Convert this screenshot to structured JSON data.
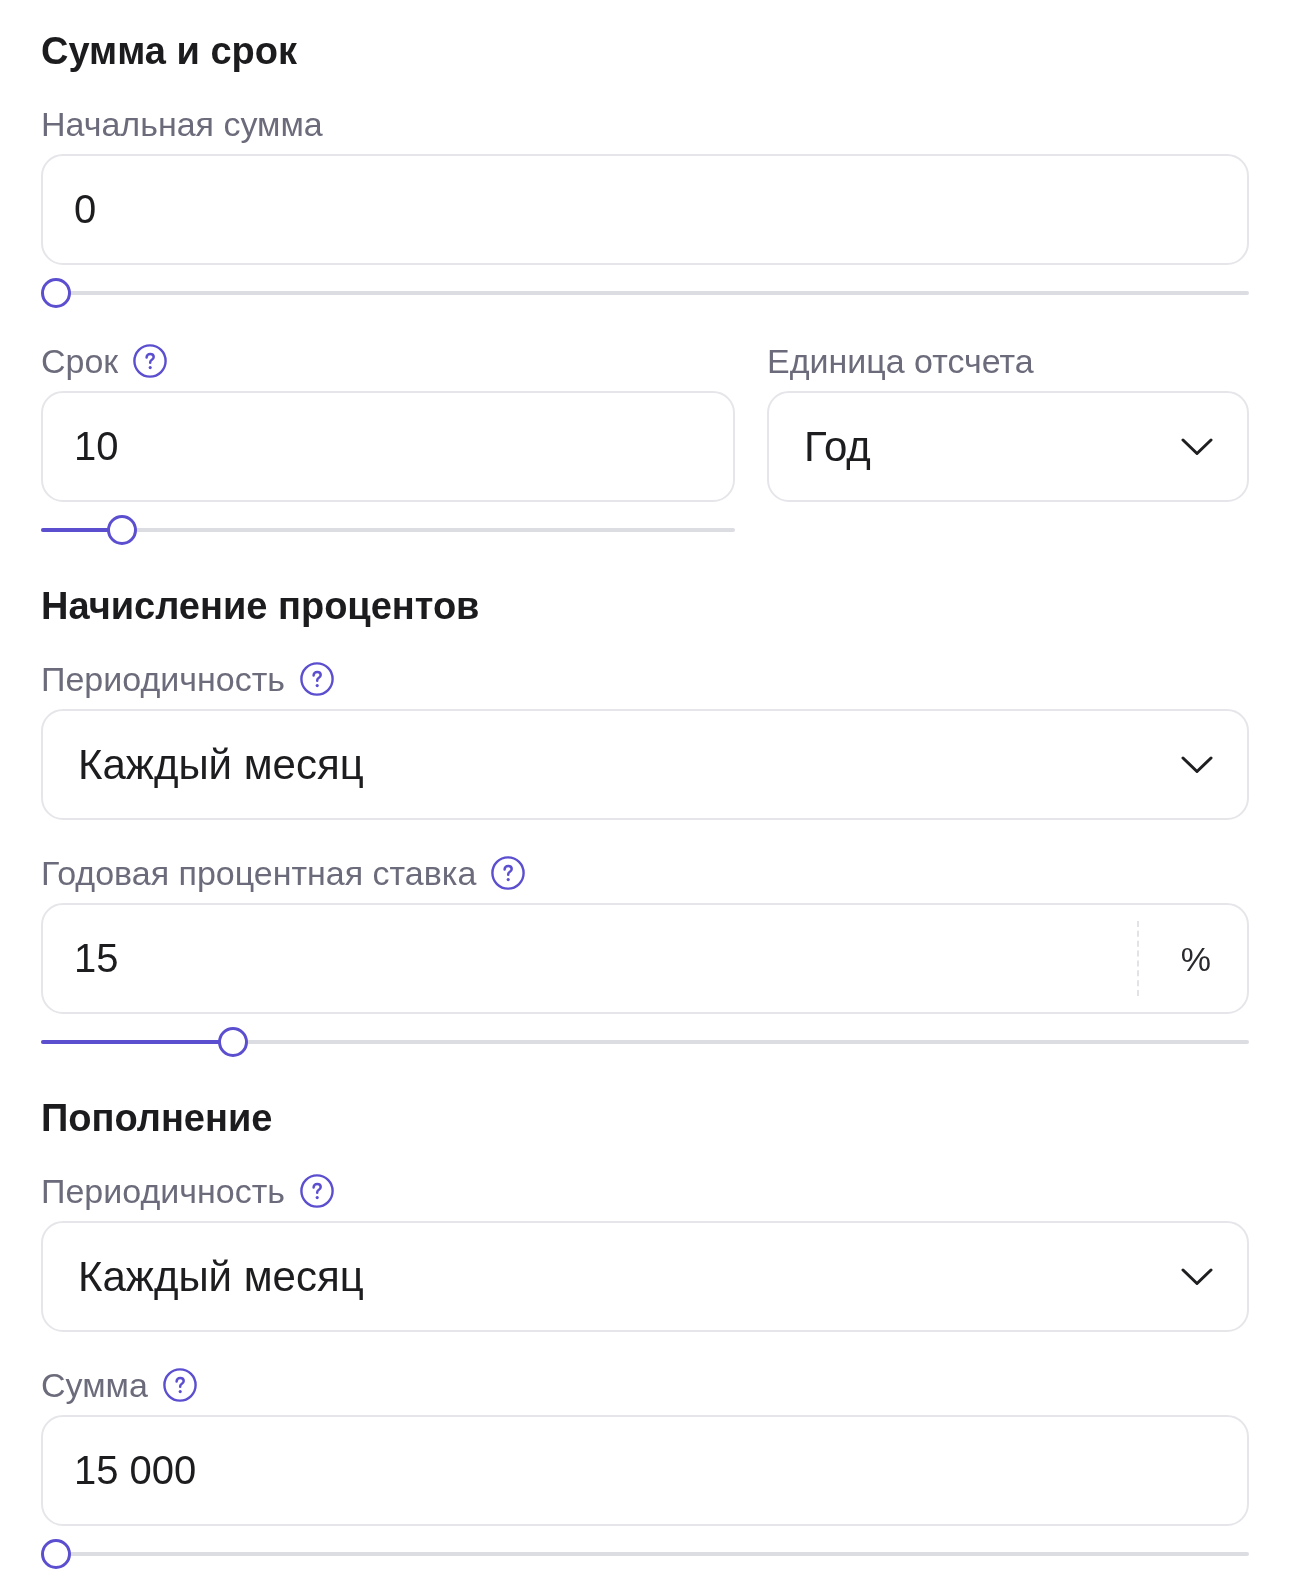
{
  "sections": [
    {
      "title": "Сумма и срок",
      "rows": [
        {
          "fields": [
            {
              "kind": "input",
              "label": "Начальная сумма",
              "help": false,
              "value": "0",
              "slider": {
                "level": 0
              }
            }
          ]
        },
        {
          "fields": [
            {
              "kind": "input",
              "label": "Срок",
              "help": true,
              "value": "10",
              "slider": {
                "level": 0.1
              }
            },
            {
              "kind": "select",
              "label": "Единица отсчета",
              "help": false,
              "value": "Год"
            }
          ]
        }
      ]
    },
    {
      "title": "Начисление процентов",
      "rows": [
        {
          "fields": [
            {
              "kind": "select",
              "label": "Периодичность",
              "help": true,
              "value": "Каждый месяц"
            }
          ]
        },
        {
          "fields": [
            {
              "kind": "input",
              "label": "Годовая процентная ставка",
              "help": true,
              "value": "15",
              "suffix": "%",
              "slider": {
                "level": 0.15
              }
            }
          ]
        }
      ]
    },
    {
      "title": "Пополнение",
      "rows": [
        {
          "fields": [
            {
              "kind": "select",
              "label": "Периодичность",
              "help": true,
              "value": "Каждый месяц"
            }
          ]
        },
        {
          "fields": [
            {
              "kind": "input",
              "label": "Сумма",
              "help": true,
              "value": "15 000",
              "slider": {
                "level": 0
              }
            }
          ]
        }
      ]
    }
  ]
}
